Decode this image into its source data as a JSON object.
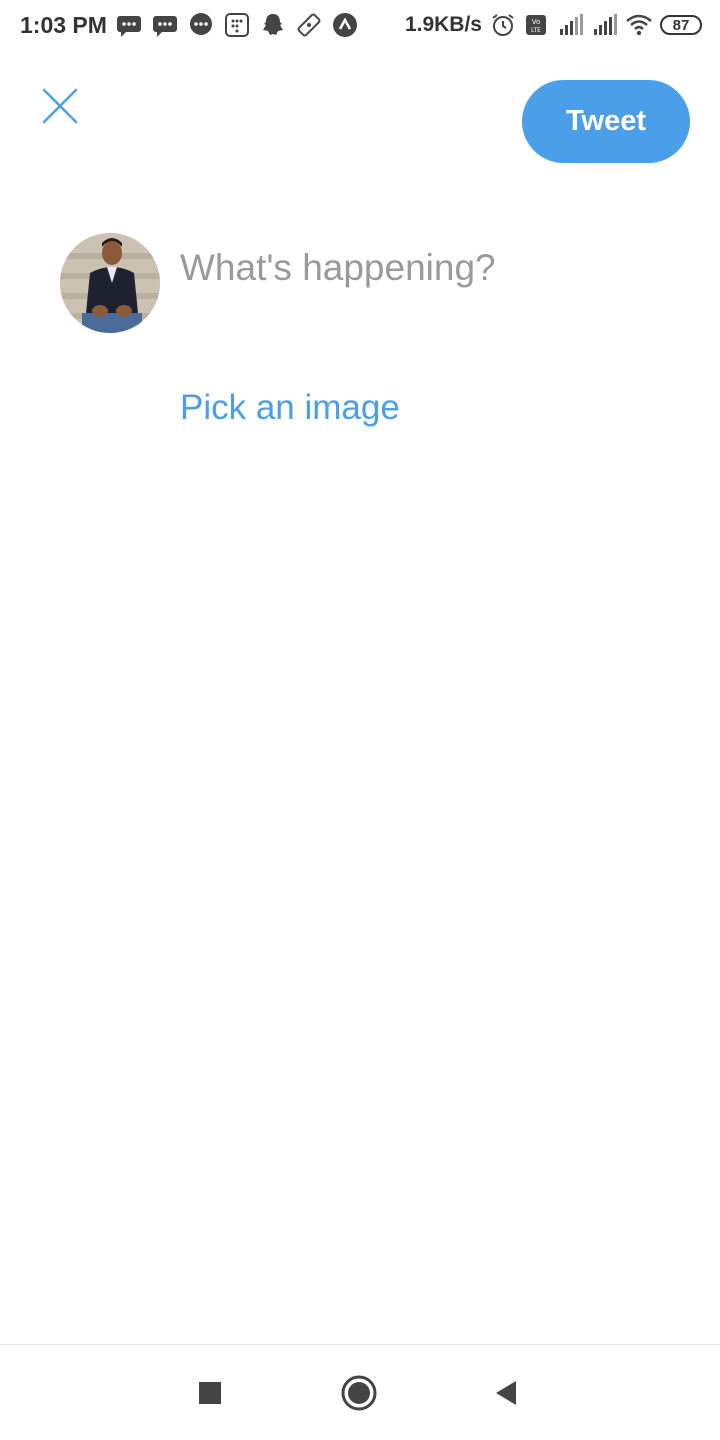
{
  "status_bar": {
    "time": "1:03 PM",
    "net_speed": "1.9KB/s",
    "battery": "87",
    "left_icons": [
      "message-icon",
      "message-icon",
      "chat-bubble-icon",
      "calculator-icon",
      "snapchat-icon",
      "ticket-icon",
      "arrow-up-icon"
    ],
    "right_icons": [
      "alarm-icon",
      "volte-icon",
      "signal-icon",
      "signal-icon",
      "wifi-icon",
      "battery-icon"
    ]
  },
  "compose": {
    "close_icon": "close-icon",
    "tweet_label": "Tweet",
    "placeholder": "What's happening?",
    "pick_image_label": "Pick an image",
    "accent_color": "#4a9fe8"
  },
  "nav_bar": {
    "icons": [
      "recents-square-icon",
      "home-circle-icon",
      "back-triangle-icon"
    ]
  }
}
